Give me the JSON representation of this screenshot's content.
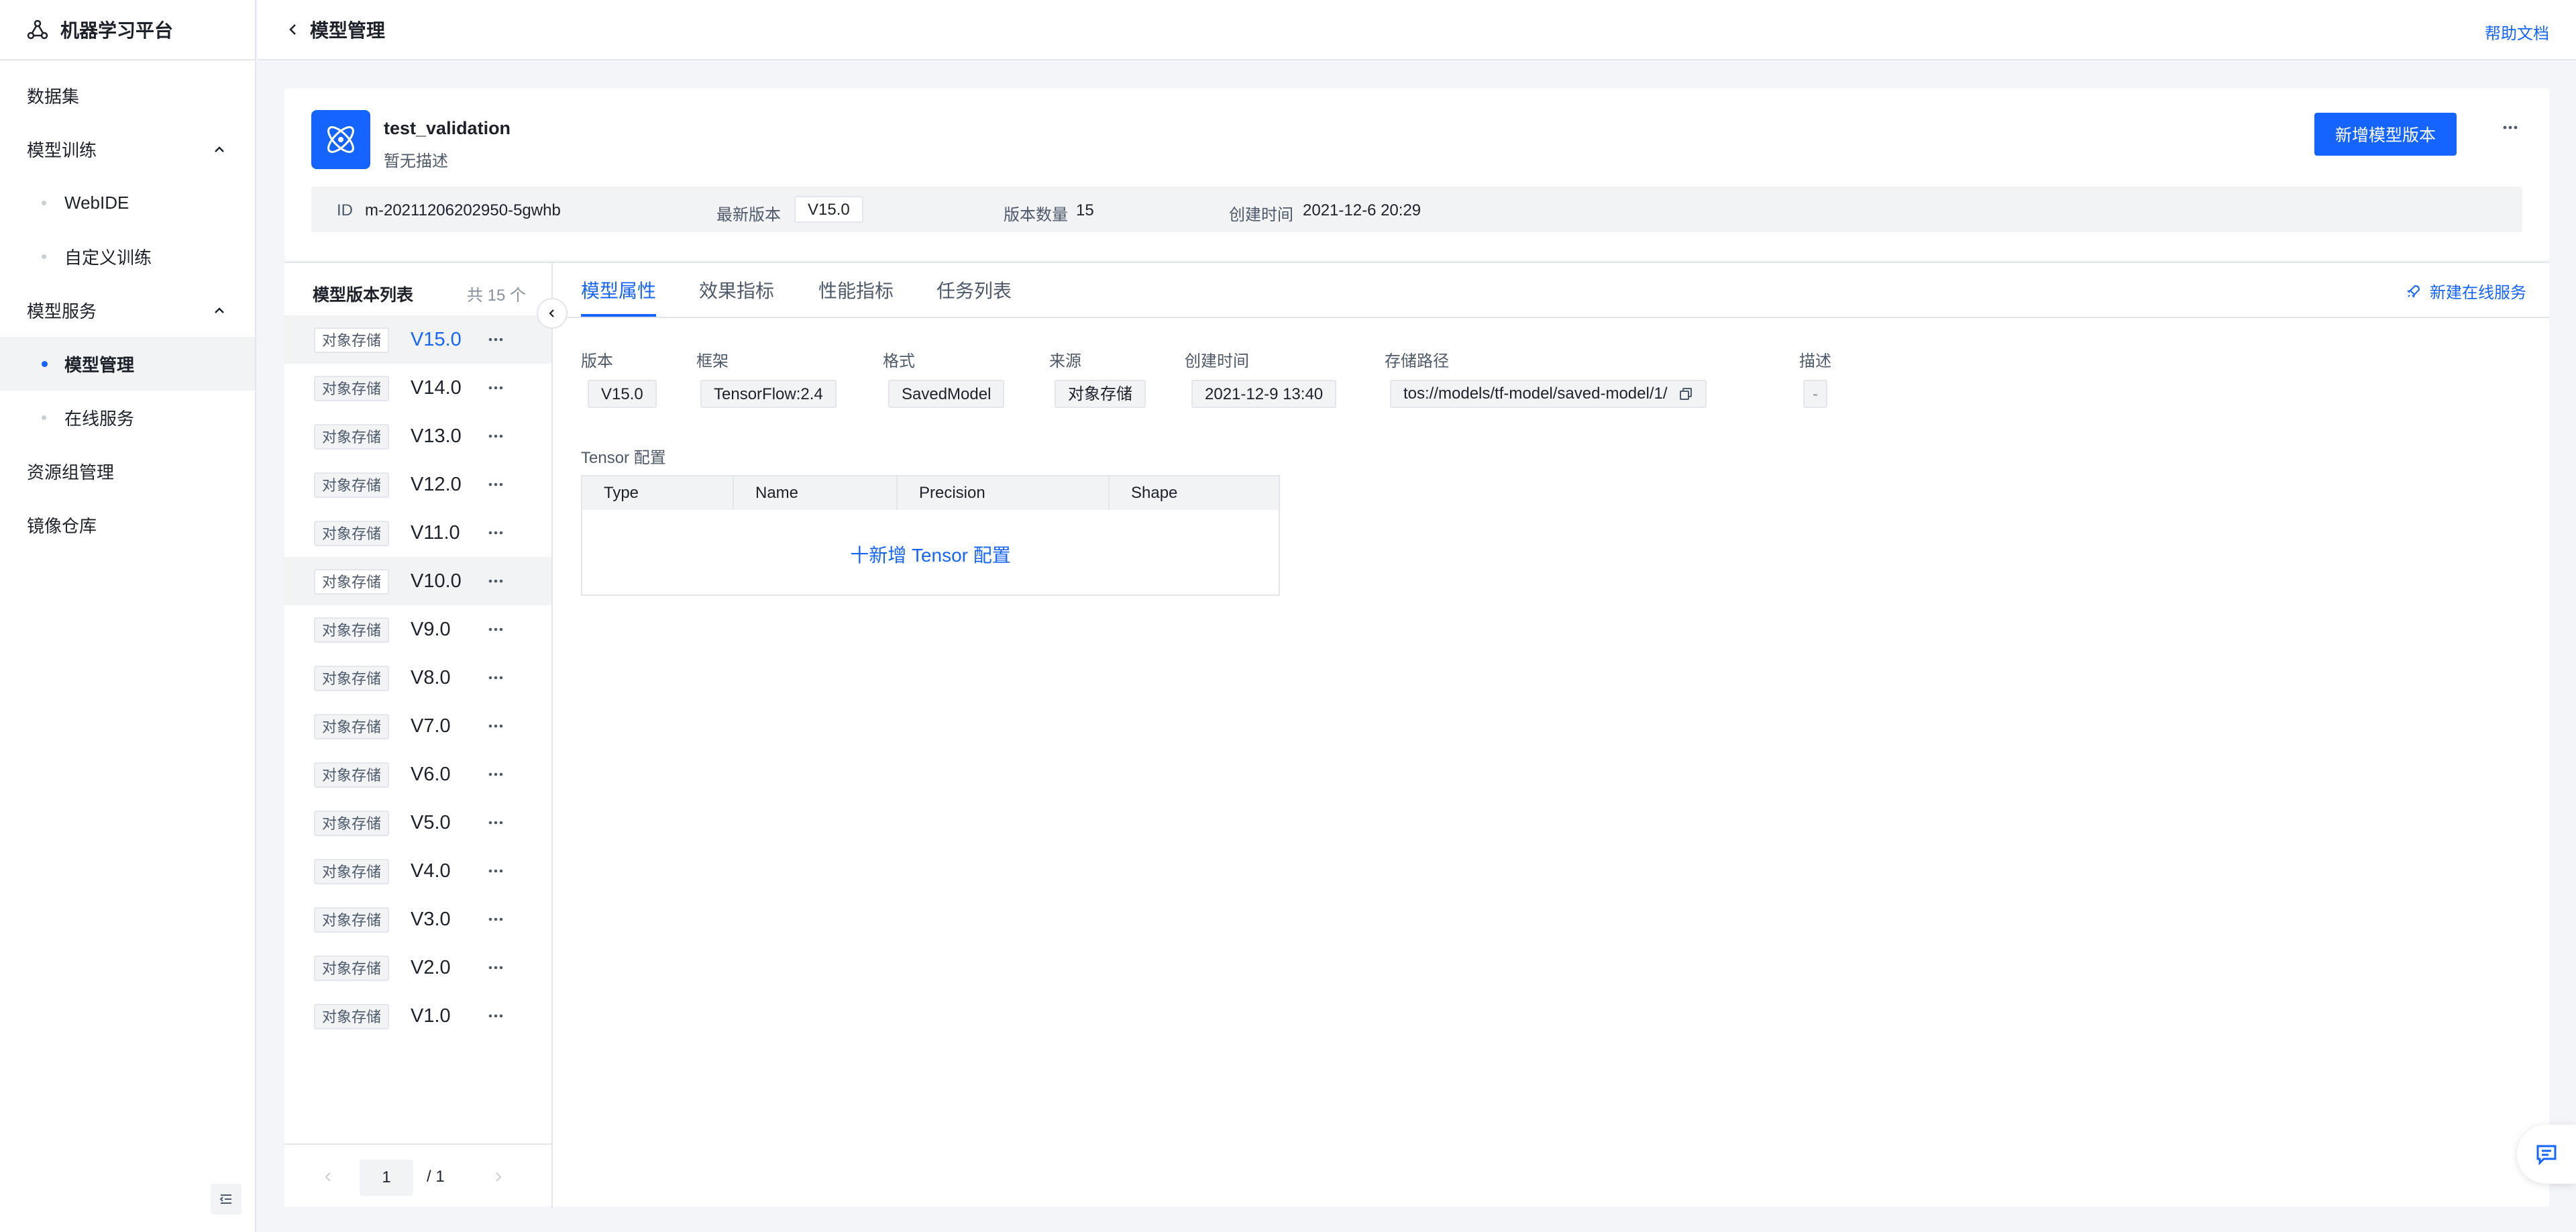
{
  "app": {
    "title": "机器学习平台",
    "help_link": "帮助文档"
  },
  "nav": {
    "dataset": "数据集",
    "training": {
      "label": "模型训练",
      "children": [
        "WebIDE",
        "自定义训练"
      ]
    },
    "serving": {
      "label": "模型服务",
      "children": [
        "模型管理",
        "在线服务"
      ]
    },
    "resource_group": "资源组管理",
    "image_repo": "镜像仓库",
    "active_item": "模型管理"
  },
  "header": {
    "title": "模型管理"
  },
  "model": {
    "name": "test_validation",
    "description": "暂无描述",
    "add_version_button": "新增模型版本",
    "info": {
      "id_label": "ID",
      "id_value": "m-20211206202950-5gwhb",
      "latest_label": "最新版本",
      "latest_value": "V15.0",
      "count_label": "版本数量",
      "count_value": "15",
      "created_label": "创建时间",
      "created_value": "2021-12-6 20:29"
    }
  },
  "version_list": {
    "title": "模型版本列表",
    "count": "共 15 个",
    "tag": "对象存储",
    "versions": [
      "V15.0",
      "V14.0",
      "V13.0",
      "V12.0",
      "V11.0",
      "V10.0",
      "V9.0",
      "V8.0",
      "V7.0",
      "V6.0",
      "V5.0",
      "V4.0",
      "V3.0",
      "V2.0",
      "V1.0"
    ],
    "selected": "V15.0",
    "pager": {
      "page": "1",
      "total": "/  1"
    }
  },
  "tabs": {
    "items": [
      "模型属性",
      "效果指标",
      "性能指标",
      "任务列表"
    ],
    "active": "模型属性",
    "new_service": "新建在线服务"
  },
  "properties": {
    "version": {
      "label": "版本",
      "value": "V15.0"
    },
    "framework": {
      "label": "框架",
      "value": "TensorFlow:2.4"
    },
    "format": {
      "label": "格式",
      "value": "SavedModel"
    },
    "source": {
      "label": "来源",
      "value": "对象存储"
    },
    "created": {
      "label": "创建时间",
      "value": "2021-12-9 13:40"
    },
    "path": {
      "label": "存储路径",
      "value": "tos://models/tf-model/saved-model/1/"
    },
    "desc": {
      "label": "描述",
      "value": "-"
    }
  },
  "tensor": {
    "label": "Tensor 配置",
    "columns": [
      "Type",
      "Name",
      "Precision",
      "Shape"
    ],
    "add_label": "十新增 Tensor 配置"
  },
  "colors": {
    "accent": "#1664ff",
    "text": "#1d2129",
    "muted": "#4e5969",
    "border": "#e5e6eb",
    "bg": "#f4f5f8"
  }
}
